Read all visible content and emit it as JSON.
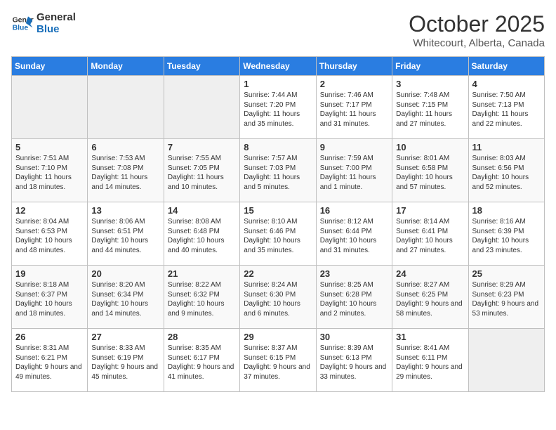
{
  "logo": {
    "line1": "General",
    "line2": "Blue"
  },
  "title": "October 2025",
  "subtitle": "Whitecourt, Alberta, Canada",
  "weekdays": [
    "Sunday",
    "Monday",
    "Tuesday",
    "Wednesday",
    "Thursday",
    "Friday",
    "Saturday"
  ],
  "weeks": [
    [
      {
        "day": "",
        "empty": true
      },
      {
        "day": "",
        "empty": true
      },
      {
        "day": "",
        "empty": true
      },
      {
        "day": "1",
        "sunrise": "7:44 AM",
        "sunset": "7:20 PM",
        "daylight": "11 hours and 35 minutes."
      },
      {
        "day": "2",
        "sunrise": "7:46 AM",
        "sunset": "7:17 PM",
        "daylight": "11 hours and 31 minutes."
      },
      {
        "day": "3",
        "sunrise": "7:48 AM",
        "sunset": "7:15 PM",
        "daylight": "11 hours and 27 minutes."
      },
      {
        "day": "4",
        "sunrise": "7:50 AM",
        "sunset": "7:13 PM",
        "daylight": "11 hours and 22 minutes."
      }
    ],
    [
      {
        "day": "5",
        "sunrise": "7:51 AM",
        "sunset": "7:10 PM",
        "daylight": "11 hours and 18 minutes."
      },
      {
        "day": "6",
        "sunrise": "7:53 AM",
        "sunset": "7:08 PM",
        "daylight": "11 hours and 14 minutes."
      },
      {
        "day": "7",
        "sunrise": "7:55 AM",
        "sunset": "7:05 PM",
        "daylight": "11 hours and 10 minutes."
      },
      {
        "day": "8",
        "sunrise": "7:57 AM",
        "sunset": "7:03 PM",
        "daylight": "11 hours and 5 minutes."
      },
      {
        "day": "9",
        "sunrise": "7:59 AM",
        "sunset": "7:00 PM",
        "daylight": "11 hours and 1 minute."
      },
      {
        "day": "10",
        "sunrise": "8:01 AM",
        "sunset": "6:58 PM",
        "daylight": "10 hours and 57 minutes."
      },
      {
        "day": "11",
        "sunrise": "8:03 AM",
        "sunset": "6:56 PM",
        "daylight": "10 hours and 52 minutes."
      }
    ],
    [
      {
        "day": "12",
        "sunrise": "8:04 AM",
        "sunset": "6:53 PM",
        "daylight": "10 hours and 48 minutes."
      },
      {
        "day": "13",
        "sunrise": "8:06 AM",
        "sunset": "6:51 PM",
        "daylight": "10 hours and 44 minutes."
      },
      {
        "day": "14",
        "sunrise": "8:08 AM",
        "sunset": "6:48 PM",
        "daylight": "10 hours and 40 minutes."
      },
      {
        "day": "15",
        "sunrise": "8:10 AM",
        "sunset": "6:46 PM",
        "daylight": "10 hours and 35 minutes."
      },
      {
        "day": "16",
        "sunrise": "8:12 AM",
        "sunset": "6:44 PM",
        "daylight": "10 hours and 31 minutes."
      },
      {
        "day": "17",
        "sunrise": "8:14 AM",
        "sunset": "6:41 PM",
        "daylight": "10 hours and 27 minutes."
      },
      {
        "day": "18",
        "sunrise": "8:16 AM",
        "sunset": "6:39 PM",
        "daylight": "10 hours and 23 minutes."
      }
    ],
    [
      {
        "day": "19",
        "sunrise": "8:18 AM",
        "sunset": "6:37 PM",
        "daylight": "10 hours and 18 minutes."
      },
      {
        "day": "20",
        "sunrise": "8:20 AM",
        "sunset": "6:34 PM",
        "daylight": "10 hours and 14 minutes."
      },
      {
        "day": "21",
        "sunrise": "8:22 AM",
        "sunset": "6:32 PM",
        "daylight": "10 hours and 9 minutes."
      },
      {
        "day": "22",
        "sunrise": "8:24 AM",
        "sunset": "6:30 PM",
        "daylight": "10 hours and 6 minutes."
      },
      {
        "day": "23",
        "sunrise": "8:25 AM",
        "sunset": "6:28 PM",
        "daylight": "10 hours and 2 minutes."
      },
      {
        "day": "24",
        "sunrise": "8:27 AM",
        "sunset": "6:25 PM",
        "daylight": "9 hours and 58 minutes."
      },
      {
        "day": "25",
        "sunrise": "8:29 AM",
        "sunset": "6:23 PM",
        "daylight": "9 hours and 53 minutes."
      }
    ],
    [
      {
        "day": "26",
        "sunrise": "8:31 AM",
        "sunset": "6:21 PM",
        "daylight": "9 hours and 49 minutes."
      },
      {
        "day": "27",
        "sunrise": "8:33 AM",
        "sunset": "6:19 PM",
        "daylight": "9 hours and 45 minutes."
      },
      {
        "day": "28",
        "sunrise": "8:35 AM",
        "sunset": "6:17 PM",
        "daylight": "9 hours and 41 minutes."
      },
      {
        "day": "29",
        "sunrise": "8:37 AM",
        "sunset": "6:15 PM",
        "daylight": "9 hours and 37 minutes."
      },
      {
        "day": "30",
        "sunrise": "8:39 AM",
        "sunset": "6:13 PM",
        "daylight": "9 hours and 33 minutes."
      },
      {
        "day": "31",
        "sunrise": "8:41 AM",
        "sunset": "6:11 PM",
        "daylight": "9 hours and 29 minutes."
      },
      {
        "day": "",
        "empty": true
      }
    ]
  ]
}
